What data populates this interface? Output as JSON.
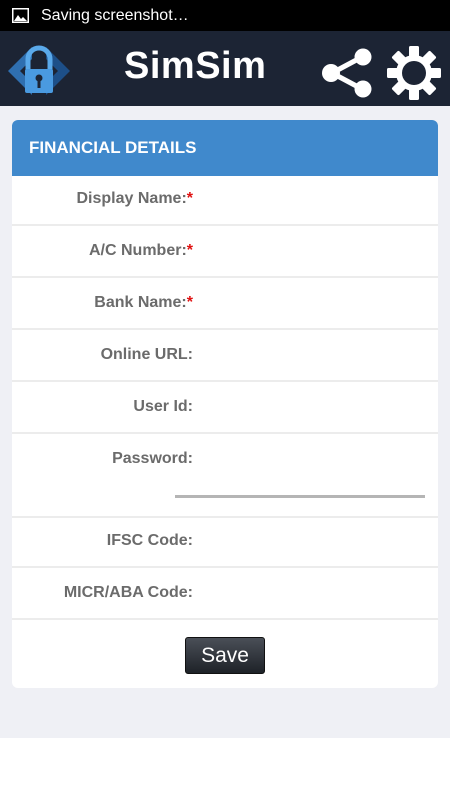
{
  "status_bar": {
    "text": "Saving screenshot…",
    "icon": "image-icon"
  },
  "app_bar": {
    "title": "SimSim",
    "logo_icon": "lock-house-logo",
    "share_icon": "share-icon",
    "settings_icon": "gear-icon",
    "background_color": "#1c2434"
  },
  "form": {
    "header": "FINANCIAL DETAILS",
    "header_color": "#4089cc",
    "required_marker": "*",
    "fields": [
      {
        "label": "Display Name:",
        "required": true,
        "value": ""
      },
      {
        "label": "A/C Number:",
        "required": true,
        "value": ""
      },
      {
        "label": "Bank Name:",
        "required": true,
        "value": ""
      },
      {
        "label": "Online URL:",
        "required": false,
        "value": ""
      },
      {
        "label": "User Id:",
        "required": false,
        "value": ""
      },
      {
        "label": "Password:",
        "required": false,
        "value": ""
      },
      {
        "label": "IFSC Code:",
        "required": false,
        "value": ""
      },
      {
        "label": "MICR/ABA Code:",
        "required": false,
        "value": ""
      }
    ],
    "save_label": "Save"
  }
}
